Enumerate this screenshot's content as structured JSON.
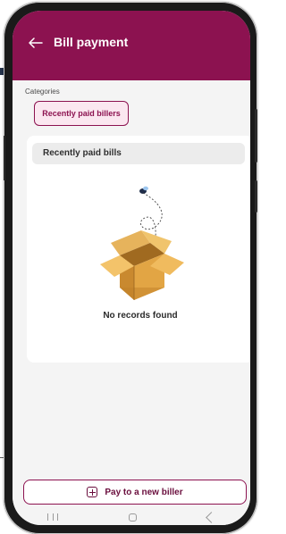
{
  "header": {
    "title": "Bill payment",
    "back_icon": "back-arrow-icon"
  },
  "categories": {
    "label": "Categories",
    "chips": [
      {
        "label": "Recently paid billers",
        "selected": true
      }
    ]
  },
  "bills_card": {
    "title": "Recently paid bills",
    "empty_message": "No records found",
    "empty_icon": "open-box-icon"
  },
  "actions": {
    "pay_new_biller_label": "Pay to a new biller",
    "pay_new_biller_icon": "plus-square-icon"
  },
  "navigation": {
    "recents_icon": "recents-icon",
    "home_icon": "home-icon",
    "back_icon": "nav-back-icon"
  },
  "colors": {
    "brand": "#8c1250",
    "chip_bg": "#fbe7f0",
    "box": "#d39a3f",
    "box_dark": "#b7802d"
  }
}
